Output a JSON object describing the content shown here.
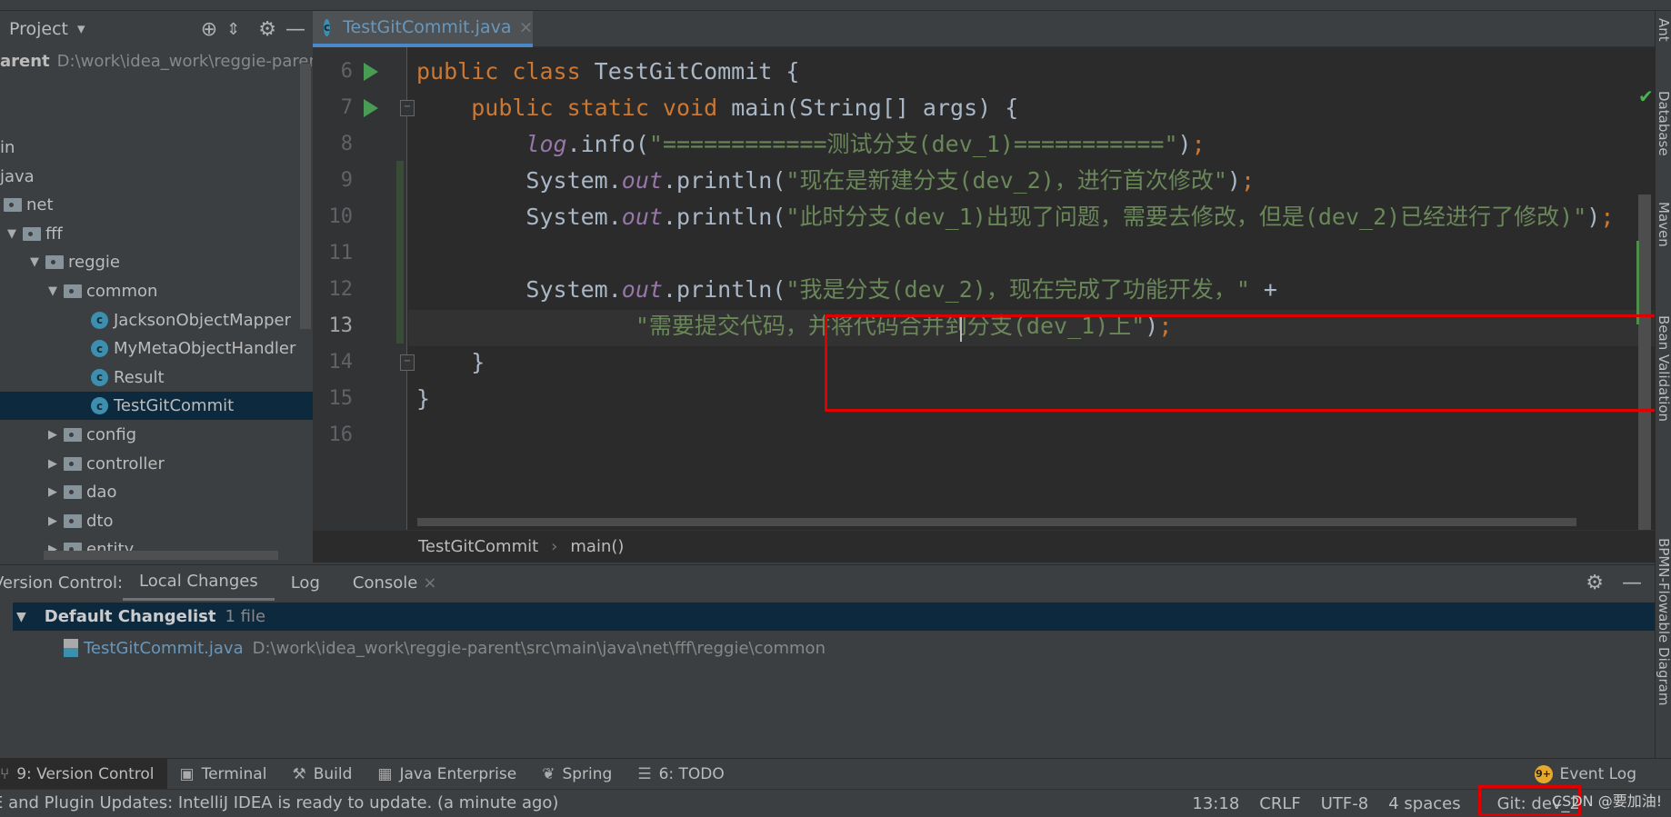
{
  "project_panel": {
    "title": "Project",
    "root_name": "arent",
    "root_path": "D:\\work\\idea_work\\reggie-parent",
    "tree": [
      {
        "label": "in",
        "depth": 0,
        "kind": "text"
      },
      {
        "label": "java",
        "depth": 0,
        "kind": "text"
      },
      {
        "label": "net",
        "depth": 0,
        "kind": "folder",
        "expanded": true
      },
      {
        "label": "fff",
        "depth": 1,
        "kind": "folder",
        "expanded": true
      },
      {
        "label": "reggie",
        "depth": 2,
        "kind": "folder",
        "expanded": true
      },
      {
        "label": "common",
        "depth": 3,
        "kind": "folder",
        "expanded": true
      },
      {
        "label": "JacksonObjectMapper",
        "depth": 4,
        "kind": "class"
      },
      {
        "label": "MyMetaObjectHandler",
        "depth": 4,
        "kind": "class"
      },
      {
        "label": "Result",
        "depth": 4,
        "kind": "class"
      },
      {
        "label": "TestGitCommit",
        "depth": 4,
        "kind": "class",
        "selected": true
      },
      {
        "label": "config",
        "depth": 3,
        "kind": "folder",
        "expanded": false
      },
      {
        "label": "controller",
        "depth": 3,
        "kind": "folder",
        "expanded": false
      },
      {
        "label": "dao",
        "depth": 3,
        "kind": "folder",
        "expanded": false
      },
      {
        "label": "dto",
        "depth": 3,
        "kind": "folder",
        "expanded": false
      },
      {
        "label": "entity",
        "depth": 3,
        "kind": "folder",
        "expanded": false
      }
    ]
  },
  "editor": {
    "tab_label": "TestGitCommit.java",
    "tab_icon_letter": "c",
    "lines": [
      {
        "n": "6",
        "run": true,
        "tokens": [
          [
            "kw",
            "public class "
          ],
          [
            "p",
            "TestGitCommit {"
          ]
        ]
      },
      {
        "n": "7",
        "run": true,
        "fold": true,
        "tokens": [
          [
            "p",
            "    "
          ],
          [
            "kw",
            "public static void "
          ],
          [
            "p",
            "main(String[] args) {"
          ]
        ]
      },
      {
        "n": "8",
        "tokens": [
          [
            "p",
            "        "
          ],
          [
            "fld",
            "log"
          ],
          [
            "p",
            ".info("
          ],
          [
            "str",
            "\"============测试分支(dev_1)===========\""
          ],
          [
            "p",
            ")"
          ],
          [
            "kw",
            ";"
          ]
        ]
      },
      {
        "n": "9",
        "tokens": [
          [
            "p",
            "        System."
          ],
          [
            "fld",
            "out"
          ],
          [
            "p",
            ".println("
          ],
          [
            "str",
            "\"现在是新建分支(dev_2)，进行首次修改\""
          ],
          [
            "p",
            ")"
          ],
          [
            "kw",
            ";"
          ]
        ]
      },
      {
        "n": "10",
        "tokens": [
          [
            "p",
            "        System."
          ],
          [
            "fld",
            "out"
          ],
          [
            "p",
            ".println("
          ],
          [
            "str",
            "\"此时分支(dev_1)出现了问题，需要去修改，但是(dev_2)已经进行了修改)\""
          ],
          [
            "p",
            ")"
          ],
          [
            "kw",
            ";"
          ]
        ]
      },
      {
        "n": "11",
        "tokens": []
      },
      {
        "n": "12",
        "tokens": [
          [
            "p",
            "        System."
          ],
          [
            "fld",
            "out"
          ],
          [
            "p",
            ".println("
          ],
          [
            "str",
            "\"我是分支(dev_2)，现在完成了功能开发，\""
          ],
          [
            "p",
            " +"
          ]
        ]
      },
      {
        "n": "13",
        "current": true,
        "tokens": [
          [
            "p",
            "                "
          ],
          [
            "str",
            "\"需要提交代码，并将代码合并到分支(dev_1)上\""
          ],
          [
            "p",
            ")"
          ],
          [
            "kw",
            ";"
          ]
        ]
      },
      {
        "n": "14",
        "fold": true,
        "tokens": [
          [
            "p",
            "    }"
          ]
        ]
      },
      {
        "n": "15",
        "tokens": [
          [
            "p",
            "}"
          ]
        ]
      },
      {
        "n": "16",
        "tokens": []
      }
    ],
    "breadcrumb": [
      "TestGitCommit",
      "main()"
    ],
    "colors": {
      "keyword": "#cc7832",
      "string": "#6a8759",
      "field": "#9876aa",
      "text": "#a9b7c6",
      "background": "#2b2b2b"
    }
  },
  "right_tools": [
    "Ant",
    "Database",
    "Maven",
    "Bean Validation",
    "BPMN-Flowable Diagram"
  ],
  "version_control": {
    "label": "Version Control:",
    "tabs": [
      "Local Changes",
      "Log",
      "Console"
    ],
    "changelist": {
      "name": "Default Changelist",
      "count": "1 file"
    },
    "file": {
      "name": "TestGitCommit.java",
      "path": "D:\\work\\idea_work\\reggie-parent\\src\\main\\java\\net\\fff\\reggie\\common"
    }
  },
  "tool_windows": [
    {
      "label": "9: Version Control",
      "icon": "branch-icon",
      "active": true
    },
    {
      "label": "Terminal",
      "icon": "terminal-icon"
    },
    {
      "label": "Build",
      "icon": "hammer-icon"
    },
    {
      "label": "Java Enterprise",
      "icon": "java-ee-icon"
    },
    {
      "label": "Spring",
      "icon": "spring-leaf-icon"
    },
    {
      "label": "6: TODO",
      "icon": "list-icon"
    }
  ],
  "event_log": {
    "label": "Event Log",
    "badge": "9+"
  },
  "status": {
    "message": "E and Plugin Updates: IntelliJ IDEA is ready to update. (a minute ago)",
    "position": "13:18",
    "line_sep": "CRLF",
    "encoding": "UTF-8",
    "indent": "4 spaces",
    "git_branch": "Git: dev_2",
    "watermark": "CSDN @要加油!"
  }
}
